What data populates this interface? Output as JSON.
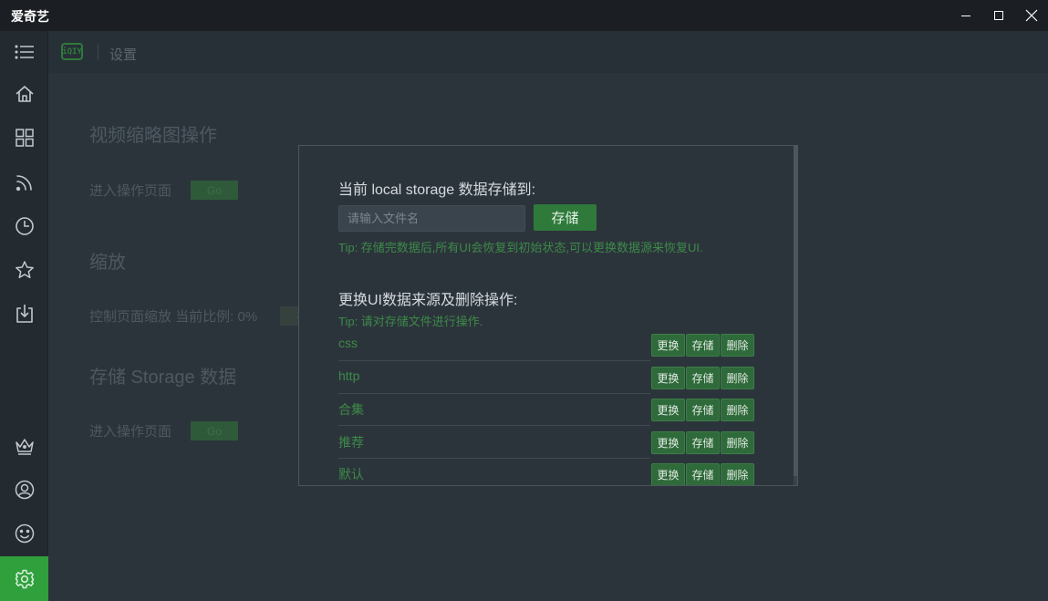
{
  "window": {
    "title": "爱奇艺"
  },
  "header": {
    "logo_text": "iQIY",
    "breadcrumb": "设置"
  },
  "sidebar": {
    "items": [
      {
        "icon": "menu-icon"
      },
      {
        "icon": "home-icon"
      },
      {
        "icon": "grid-icon"
      },
      {
        "icon": "rss-icon"
      },
      {
        "icon": "clock-icon"
      },
      {
        "icon": "star-icon"
      },
      {
        "icon": "download-icon"
      },
      {
        "icon": "crown-icon"
      },
      {
        "icon": "user-icon"
      },
      {
        "icon": "smile-icon"
      },
      {
        "icon": "gear-icon",
        "active": true
      }
    ],
    "active_color": "#30a03d"
  },
  "settings": {
    "thumbnail": {
      "title": "视频缩略图操作",
      "label": "进入操作页面",
      "button": "Go"
    },
    "zoom": {
      "title": "缩放",
      "label": "控制页面缩放 当前比例: 0%",
      "minus": "-"
    },
    "storage": {
      "title": "存储 Storage 数据",
      "label": "进入操作页面",
      "button": "Go"
    }
  },
  "modal": {
    "save_heading": "当前 local storage 数据存储到:",
    "filename_placeholder": "请输入文件名",
    "save_button": "存储",
    "save_tip": "Tip: 存储完数据后,所有UI会恢复到初始状态,可以更换数据源来恢复UI.",
    "manage_heading": "更换UI数据来源及删除操作:",
    "manage_tip": "Tip: 请对存储文件进行操作.",
    "actions": {
      "replace": "更换",
      "store": "存储",
      "delete": "删除"
    },
    "files": [
      "css",
      "http",
      "合集",
      "推荐",
      "默认"
    ]
  },
  "colors": {
    "accent": "#2f7a3a",
    "tip": "#3c8a48",
    "background": "#2c343b"
  }
}
